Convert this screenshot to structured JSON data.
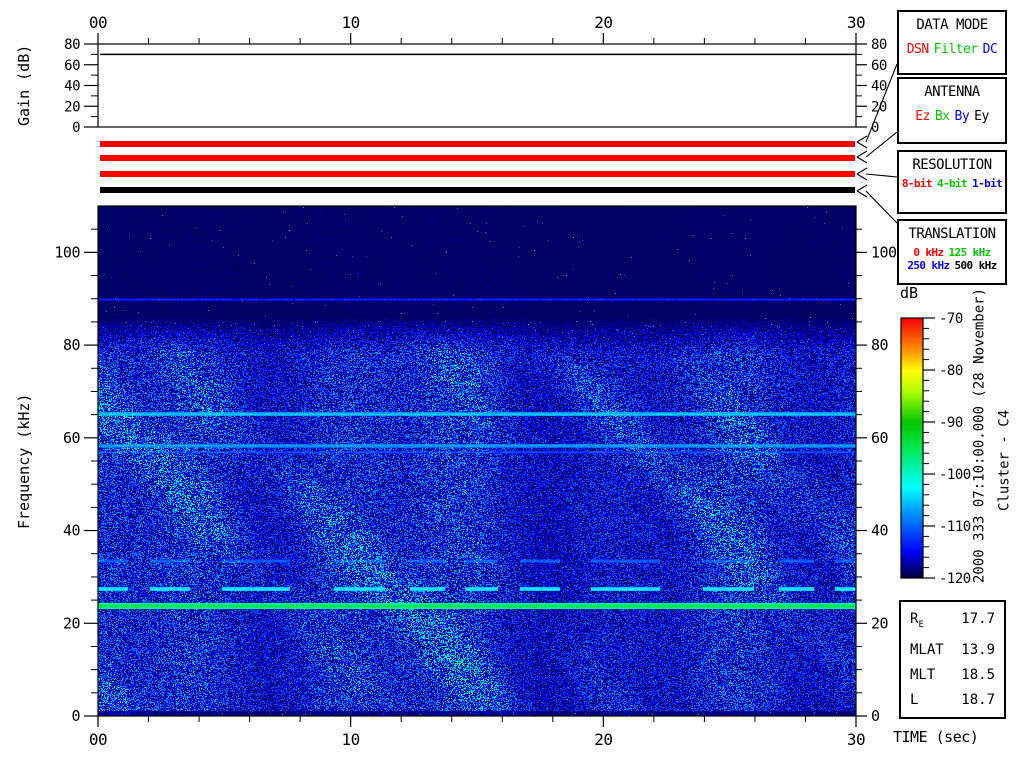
{
  "top_axis": {
    "tick_labels": [
      "00",
      "10",
      "20",
      "30"
    ]
  },
  "gain_panel": {
    "ylabel": "Gain (dB)",
    "y_range": [
      0,
      80
    ],
    "ytick_labels": [
      "0",
      "20",
      "40",
      "60",
      "80"
    ],
    "y_minor_step": 10,
    "gain_line_db": 70
  },
  "status_bars": [
    {
      "name": "data-mode-bar",
      "color": "#ff0000"
    },
    {
      "name": "antenna-bar",
      "color": "#ff0000"
    },
    {
      "name": "resolution-bar",
      "color": "#ff0000"
    },
    {
      "name": "translation-bar",
      "color": "#000000"
    }
  ],
  "legend_boxes": [
    {
      "id": "data-mode",
      "title": "DATA MODE",
      "size": "lg",
      "rows": [
        [
          {
            "label": "DSN",
            "color": "#ff0000"
          },
          {
            "label": "Filter",
            "color": "#00c800"
          },
          {
            "label": "DC",
            "color": "#0000ff"
          }
        ]
      ]
    },
    {
      "id": "antenna",
      "title": "ANTENNA",
      "size": "lg",
      "rows": [
        [
          {
            "label": "Ez",
            "color": "#ff0000"
          },
          {
            "label": "Bx",
            "color": "#00c800"
          },
          {
            "label": "By",
            "color": "#0000ff"
          },
          {
            "label": "Ey",
            "color": "#000000"
          }
        ]
      ]
    },
    {
      "id": "resolution",
      "title": "RESOLUTION",
      "size": "sm",
      "rows": [
        [
          {
            "label": "8-bit",
            "color": "#ff0000"
          },
          {
            "label": "4-bit",
            "color": "#00c800"
          },
          {
            "label": "1-bit",
            "color": "#0000ff"
          }
        ]
      ]
    },
    {
      "id": "translation",
      "title": "TRANSLATION",
      "size": "sm",
      "rows": [
        [
          {
            "label": "0 kHz",
            "color": "#ff0000"
          },
          {
            "label": "125 kHz",
            "color": "#00c800"
          }
        ],
        [
          {
            "label": "250 kHz",
            "color": "#0000ff"
          },
          {
            "label": "500 kHz",
            "color": "#000000"
          }
        ]
      ]
    }
  ],
  "chart_data": {
    "type": "heatmap",
    "xlabel": "TIME (sec)",
    "ylabel": "Frequency (kHz)",
    "x_range_sec": [
      0,
      30
    ],
    "x_ticks": [
      0,
      10,
      20,
      30
    ],
    "x_tick_labels": [
      "00",
      "10",
      "20",
      "30"
    ],
    "x_minor_step": 2,
    "y_range_khz": [
      0,
      110
    ],
    "y_ticks": [
      0,
      20,
      40,
      60,
      80,
      100
    ],
    "y_minor_step": 5,
    "colorbar": {
      "label": "dB",
      "range_db": [
        -120,
        -70
      ],
      "tick_values": [
        -70,
        -80,
        -90,
        -100,
        -110,
        -120
      ],
      "tick_labels": [
        "-70",
        "-80",
        "-90",
        "-100",
        "-110",
        "-120"
      ],
      "minor_step": 2,
      "stops": [
        [
          0,
          [
            0,
            0,
            60
          ]
        ],
        [
          0.1,
          [
            0,
            0,
            255
          ]
        ],
        [
          0.25,
          [
            0,
            150,
            255
          ]
        ],
        [
          0.35,
          [
            0,
            255,
            255
          ]
        ],
        [
          0.5,
          [
            0,
            230,
            80
          ]
        ],
        [
          0.6,
          [
            0,
            200,
            0
          ]
        ],
        [
          0.72,
          [
            180,
            255,
            0
          ]
        ],
        [
          0.8,
          [
            255,
            255,
            0
          ]
        ],
        [
          0.88,
          [
            255,
            140,
            0
          ]
        ],
        [
          1.0,
          [
            255,
            0,
            0
          ]
        ]
      ]
    },
    "noise_floor_db": -119,
    "noise_band_max_khz": 84,
    "spectral_lines": [
      {
        "freq_khz": 89.9,
        "level_db": -114,
        "style": "faint"
      },
      {
        "freq_khz": 65.2,
        "level_db": -106,
        "style": "solid"
      },
      {
        "freq_khz": 58.4,
        "level_db": -108,
        "style": "solid"
      },
      {
        "freq_khz": 57.0,
        "level_db": -112,
        "style": "faint"
      },
      {
        "freq_khz": 33.5,
        "level_db": -111,
        "style": "patchy"
      },
      {
        "freq_khz": 27.5,
        "level_db": -104,
        "style": "patchy"
      },
      {
        "freq_khz": 23.8,
        "level_db": -96,
        "style": "bright"
      }
    ],
    "gain_line": {
      "value_db": 70
    }
  },
  "side_text": {
    "timestamp": "2000 333 07:10:00.000 (28 November)",
    "spacecraft": "Cluster - C4"
  },
  "ephemeris": {
    "rows": [
      {
        "label": "R",
        "sub": "E",
        "value": "17.7"
      },
      {
        "label": "MLAT",
        "value": "13.9"
      },
      {
        "label": "MLT",
        "value": "18.5"
      },
      {
        "label": "L",
        "value": "18.7"
      }
    ]
  },
  "footer": {
    "xlabel": "TIME (sec)"
  }
}
